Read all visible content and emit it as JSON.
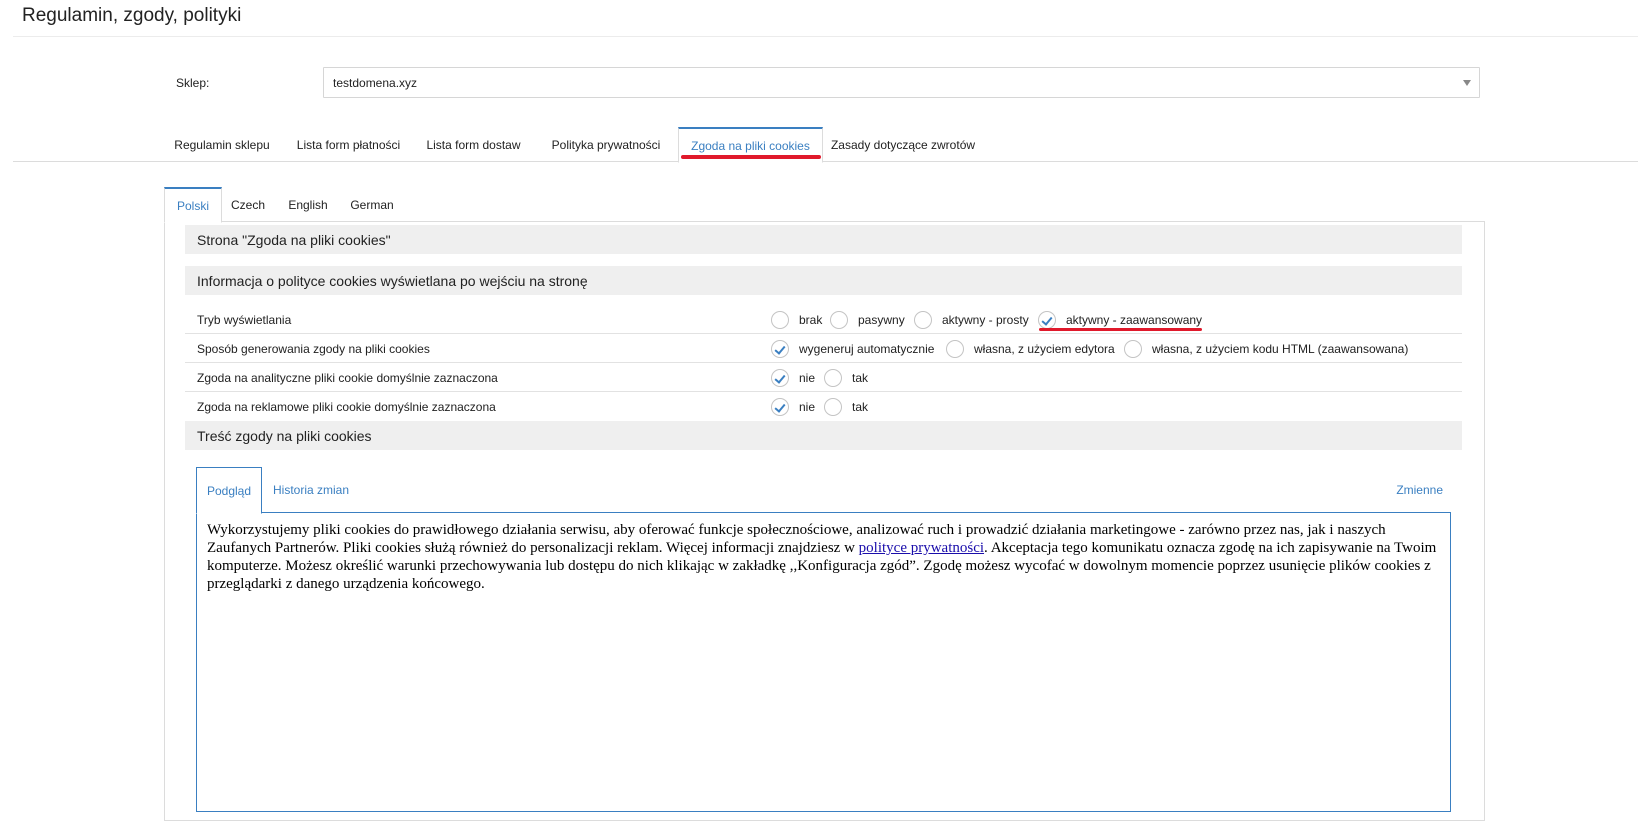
{
  "page": {
    "title": "Regulamin, zgody, polityki"
  },
  "shop": {
    "label": "Sklep:",
    "value": "testdomena.xyz"
  },
  "main_tabs": [
    {
      "label": "Regulamin sklepu"
    },
    {
      "label": "Lista form płatności"
    },
    {
      "label": "Lista form dostaw"
    },
    {
      "label": "Polityka prywatności"
    },
    {
      "label": "Zgoda na pliki cookies"
    },
    {
      "label": "Zasady dotyczące zwrotów"
    }
  ],
  "main_tabs_active": "Zgoda na pliki cookies",
  "lang_tabs": [
    {
      "label": "Polski"
    },
    {
      "label": "Czech"
    },
    {
      "label": "English"
    },
    {
      "label": "German"
    }
  ],
  "lang_tabs_active": "Polski",
  "sections": {
    "page_section": "Strona \"Zgoda na pliki cookies\"",
    "info_section": "Informacja o polityce cookies wyświetlana po wejściu na stronę",
    "content_section": "Treść zgody na pliki cookies"
  },
  "rows": [
    {
      "label": "Tryb wyświetlania",
      "options": [
        {
          "label": "brak",
          "checked": false
        },
        {
          "label": "pasywny",
          "checked": false
        },
        {
          "label": "aktywny - prosty",
          "checked": false
        },
        {
          "label": "aktywny - zaawansowany",
          "checked": true
        }
      ]
    },
    {
      "label": "Sposób generowania zgody na pliki cookies",
      "options": [
        {
          "label": "wygeneruj automatycznie",
          "checked": true
        },
        {
          "label": "własna, z użyciem edytora",
          "checked": false
        },
        {
          "label": "własna, z użyciem kodu HTML (zaawansowana)",
          "checked": false
        }
      ]
    },
    {
      "label": "Zgoda na analityczne pliki cookie domyślnie zaznaczona",
      "options": [
        {
          "label": "nie",
          "checked": true
        },
        {
          "label": "tak",
          "checked": false
        }
      ]
    },
    {
      "label": "Zgoda na reklamowe pliki cookie domyślnie zaznaczona",
      "options": [
        {
          "label": "nie",
          "checked": true
        },
        {
          "label": "tak",
          "checked": false
        }
      ]
    }
  ],
  "content_tabs": [
    {
      "label": "Podgląd"
    },
    {
      "label": "Historia zmian"
    }
  ],
  "content_tabs_active": "Podgląd",
  "variables_link": "Zmienne",
  "preview": {
    "text_before_link": "Wykorzystujemy pliki cookies do prawidłowego działania serwisu, aby oferować funkcje społecznościowe, analizować ruch i prowadzić działania marketingowe - zarówno przez nas, jak i naszych Zaufanych Partnerów. Pliki cookies służą również do personalizacji reklam. Więcej informacji znajdziesz w ",
    "link_text": "polityce prywatności",
    "text_after_link": ". Akceptacja tego komunikatu oznacza zgodę na ich zapisywanie na Twoim komputerze. Możesz określić warunki przechowywania lub dostępu do nich klikając w zakładkę ,,Konfiguracja zgód”. Zgodę możesz wycofać w dowolnym momencie poprzez usunięcie plików cookies z przeglądarki z danego urządzenia końcowego."
  },
  "colors": {
    "accent": "#3a7fc1",
    "highlight": "#e0192b",
    "section_bg": "#efefef"
  }
}
